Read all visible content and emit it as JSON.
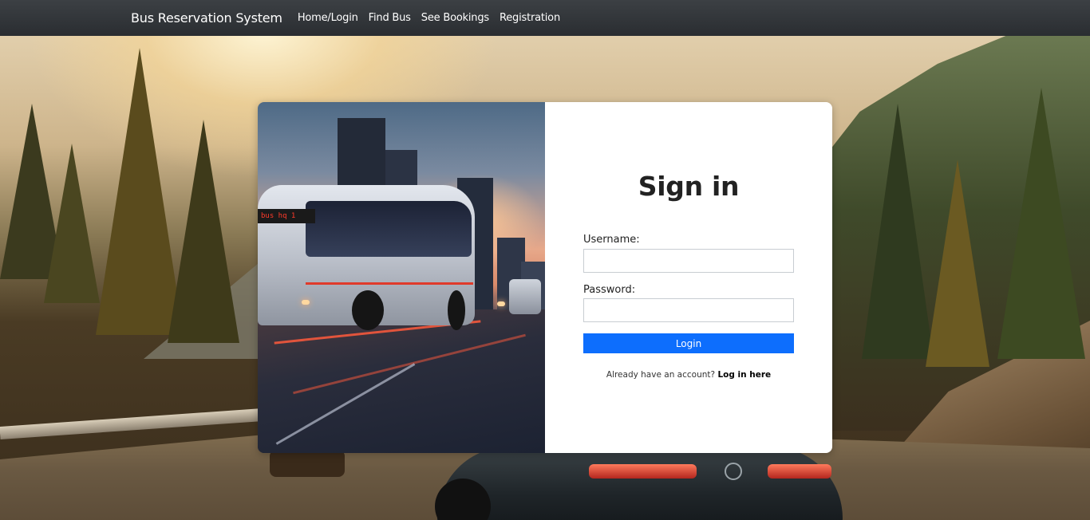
{
  "navbar": {
    "brand": "Bus Reservation System",
    "links": [
      "Home/Login",
      "Find Bus",
      "See Bookings",
      "Registration"
    ]
  },
  "image": {
    "bus_sign": "bus hq 1"
  },
  "form": {
    "title": "Sign in",
    "username_label": "Username:",
    "username_value": "",
    "password_label": "Password:",
    "password_value": "",
    "login_label": "Login",
    "account_prompt": "Already have an account?",
    "account_link": "Log in here"
  },
  "colors": {
    "navbar": "#2a2d31",
    "primary_button": "#0d6efd",
    "card_background": "#ffffff"
  }
}
